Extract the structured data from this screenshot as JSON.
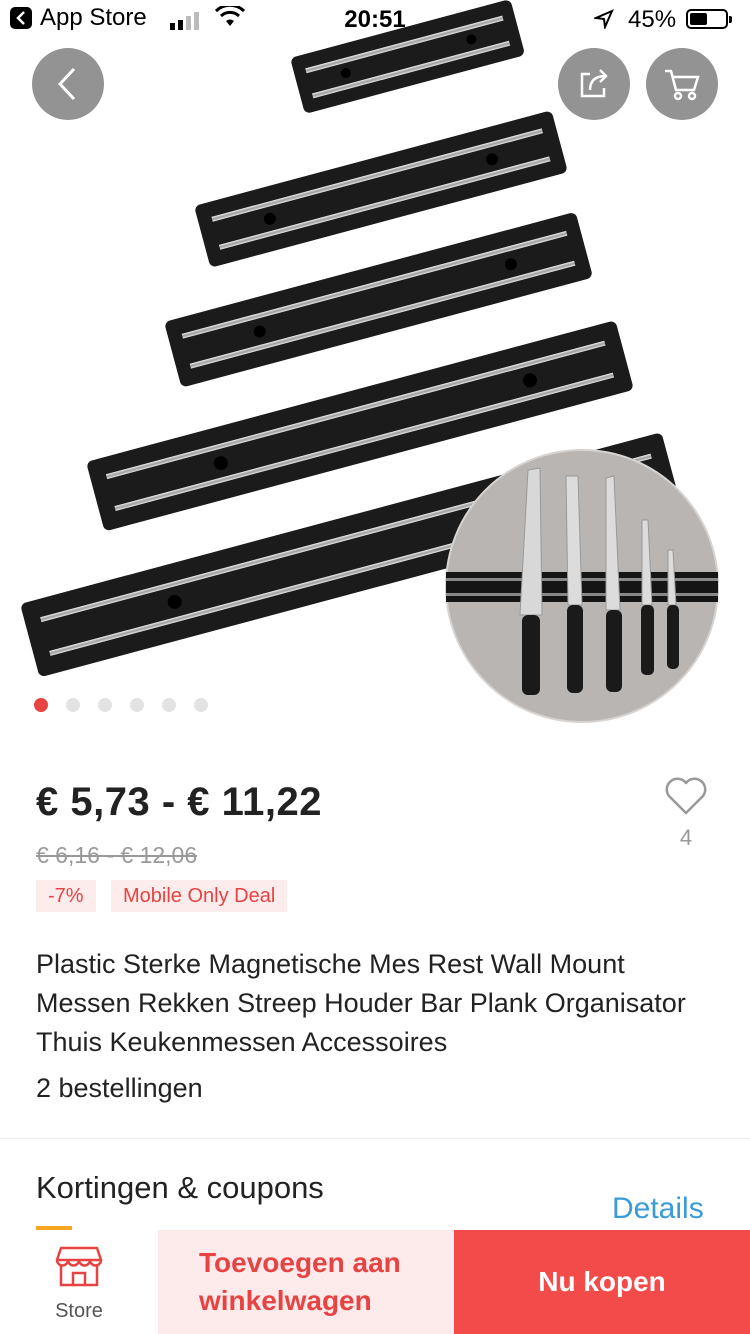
{
  "status_bar": {
    "back_app": "App Store",
    "time": "20:51",
    "battery": "45%"
  },
  "gallery": {
    "image_count": 6,
    "active_index": 0
  },
  "product": {
    "price": "€ 5,73 - € 11,22",
    "old_price": "€ 6,16 - € 12,06",
    "discount_badge": "-7%",
    "deal_badge": "Mobile Only Deal",
    "wishlist_count": "4",
    "title": "Plastic Sterke Magnetische Mes Rest Wall Mount Messen Rekken Streep Houder Bar Plank Organisator Thuis Keukenmessen Accessoires",
    "orders": "2 bestellingen"
  },
  "coupons": {
    "heading": "Kortingen & coupons",
    "details_link": "Details"
  },
  "bottom_bar": {
    "store_label": "Store",
    "add_to_cart": "Toevoegen aan winkelwagen",
    "buy_now": "Nu kopen"
  },
  "colors": {
    "accent": "#e84343",
    "buy_button": "#f34a4a",
    "link": "#3b9bd6"
  }
}
